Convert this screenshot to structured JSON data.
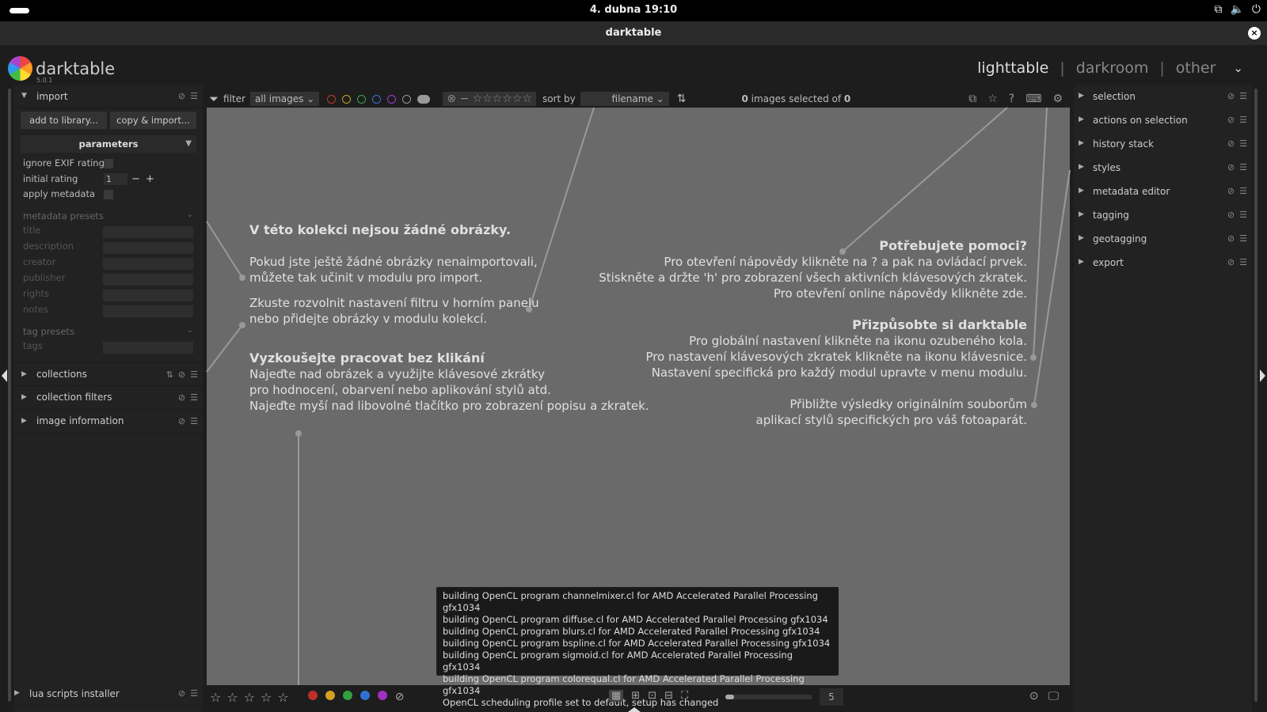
{
  "system": {
    "clock": "4. dubna  19:10",
    "icons": [
      "network-icon",
      "volume-icon",
      "power-icon"
    ]
  },
  "window": {
    "title": "darktable",
    "close": "×"
  },
  "app": {
    "name": "darktable",
    "version": "5.0.1",
    "views": {
      "lighttable": "lighttable",
      "sep": "|",
      "darkroom": "darkroom",
      "other": "other",
      "more": "⌄"
    }
  },
  "left": {
    "import": {
      "title": "import",
      "add_btn": "add to library...",
      "copy_btn": "copy & import...",
      "params_title": "parameters",
      "ignore_exif": "ignore EXIF rating",
      "initial_rating": "initial rating",
      "initial_rating_value": "1",
      "minus": "−",
      "plus": "+",
      "apply_metadata": "apply metadata",
      "metadata_presets": "metadata presets",
      "meta_fields": [
        "title",
        "description",
        "creator",
        "publisher",
        "rights",
        "notes"
      ],
      "tag_presets": "tag presets",
      "tags": "tags"
    },
    "modules": [
      "collections",
      "collection filters",
      "image information"
    ],
    "lua": "lua scripts installer"
  },
  "toolbar": {
    "filter_label": "filter",
    "filter_value": "all images",
    "sort_label": "sort by",
    "sort_value": "filename",
    "selected_count": "0",
    "selected_text": " images selected of ",
    "total_count": "0",
    "color_dots": [
      "#c0392b",
      "#c9a227",
      "#3aa84a",
      "#3a6fd0",
      "#a13ad0",
      "#999999"
    ]
  },
  "help": {
    "empty_title": "V této kolekci nejsou žádné obrázky.",
    "empty_p1a": "Pokud jste ještě žádné obrázky nenaimportovali,",
    "empty_p1b": "můžete tak učinit v modulu pro import.",
    "empty_p2a": "Zkuste rozvolnit nastavení filtru v horním panelu",
    "empty_p2b": "nebo přidejte obrázky v modulu kolekcí.",
    "try_title": "Vyzkoušejte pracovat bez klikání",
    "try_1": "Najeďte nad obrázek a využijte klávesové zkrátky",
    "try_2": "pro hodnocení, obarvení nebo aplikování stylů atd.",
    "try_3": "Najeďte myší nad libovolné tlačítko pro zobrazení popisu a zkratek.",
    "need_title": "Potřebujete pomoci?",
    "need_1": "Pro otevření nápovědy klikněte na ? a pak na ovládací prvek.",
    "need_2": "Stiskněte a držte 'h' pro zobrazení všech aktivních klávesových zkratek.",
    "need_3": "Pro otevření online nápovědy klikněte zde.",
    "custom_title": "Přizpůsobte si darktable",
    "custom_1": "Pro globální nastavení klikněte na ikonu ozubeného kola.",
    "custom_2": "Pro nastavení klávesových zkratek klikněte na ikonu klávesnice.",
    "custom_3": "Nastavení specifická pro každý modul upravte v menu modulu.",
    "approx_1": "Přibližte výsledky originálním souborům",
    "approx_2": "aplikací stylů specifických pro váš fotoaparát."
  },
  "log": [
    "building OpenCL program channelmixer.cl for AMD Accelerated Parallel Processing gfx1034",
    "building OpenCL program diffuse.cl for AMD Accelerated Parallel Processing gfx1034",
    "building OpenCL program blurs.cl for AMD Accelerated Parallel Processing gfx1034",
    "building OpenCL program bspline.cl for AMD Accelerated Parallel Processing gfx1034",
    "building OpenCL program sigmoid.cl for AMD Accelerated Parallel Processing gfx1034",
    "building OpenCL program colorequal.cl for AMD Accelerated Parallel Processing gfx1034",
    "OpenCL scheduling profile set to default, setup has changed"
  ],
  "right": {
    "modules": [
      "selection",
      "actions on selection",
      "history stack",
      "styles",
      "metadata editor",
      "tagging",
      "geotagging",
      "export"
    ]
  },
  "bottom": {
    "zoom_value": "5",
    "zoom_fraction": 0.1,
    "colors": [
      "#c0302a",
      "#d4a020",
      "#30a040",
      "#3070d0",
      "#a030c0"
    ]
  }
}
